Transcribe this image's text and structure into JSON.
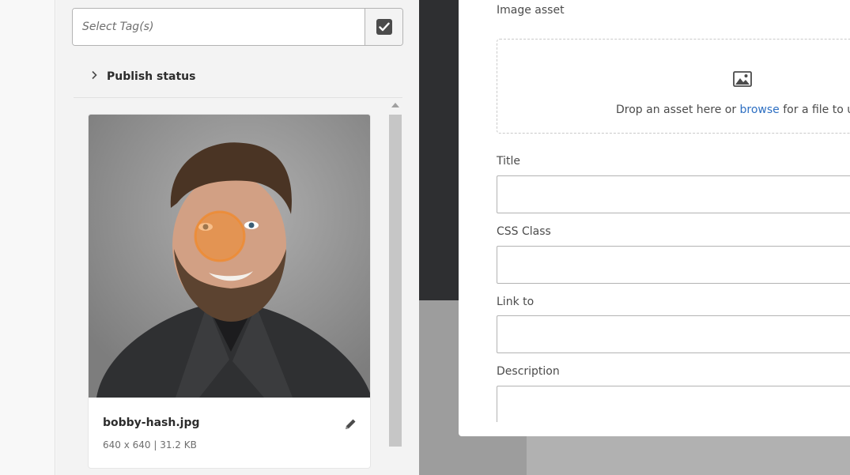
{
  "tags": {
    "placeholder": "Select Tag(s)",
    "confirm_icon": "checkbox-checked-icon"
  },
  "filters": {
    "publish_status_label": "Publish status",
    "expand_icon": "chevron-right-icon"
  },
  "asset_card": {
    "filename": "bobby-hash.jpg",
    "meta": "640 x 640 | 31.2 KB",
    "edit_icon": "pencil-icon"
  },
  "dialog": {
    "image_asset_label": "Image asset",
    "dropzone": {
      "icon": "image-icon",
      "text_before": "Drop an asset here or ",
      "link": "browse",
      "text_after": " for a file to uplo"
    },
    "title_label": "Title",
    "css_class_label": "CSS Class",
    "link_to_label": "Link to",
    "description_label": "Description"
  },
  "colors": {
    "link": "#2d6fc2",
    "overlay_dark": "#2e2f31",
    "cursor_highlight": "#f08a2c"
  }
}
